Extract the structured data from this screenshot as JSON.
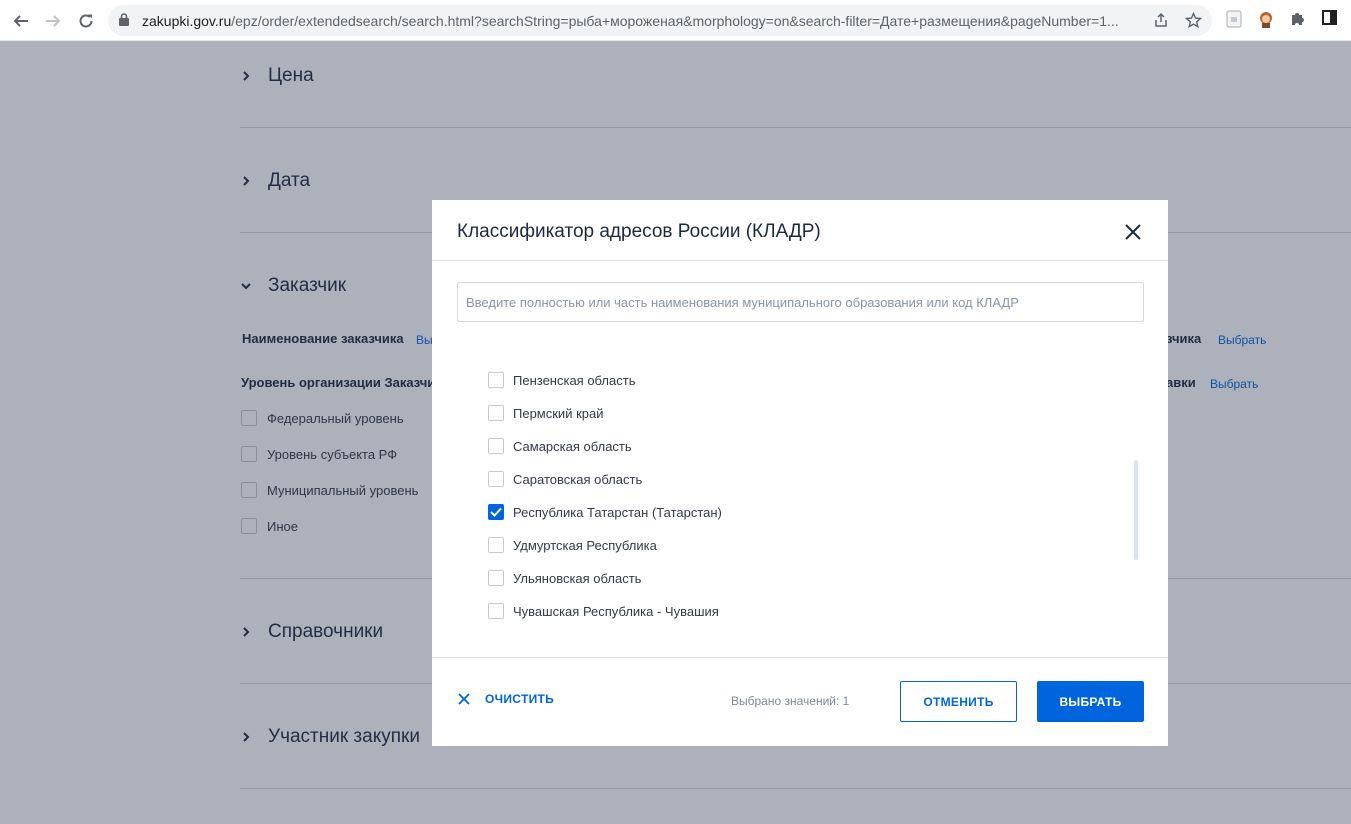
{
  "browser": {
    "url_domain": "zakupki.gov.ru",
    "url_path": "/epz/order/extendedsearch/search.html?searchString=рыба+мороженая&morphology=on&search-filter=Дате+размещения&pageNumber=1..."
  },
  "background": {
    "sections": [
      {
        "title": "Цена",
        "expanded": false
      },
      {
        "title": "Дата",
        "expanded": false
      },
      {
        "title": "Заказчик",
        "expanded": true
      },
      {
        "title": "Справочники",
        "expanded": false
      },
      {
        "title": "Участник закупки",
        "expanded": false
      }
    ],
    "customer_name_label": "Наименование заказчика",
    "customer_name_link": "Вы",
    "org_level_label": "Уровень организации Заказчик",
    "right_label_1": "зчика",
    "right_link_1": "Выбрать",
    "right_label_2": "авки",
    "right_link_2": "Выбрать",
    "levels": [
      "Федеральный уровень",
      "Уровень субъекта РФ",
      "Муниципальный уровень",
      "Иное"
    ]
  },
  "modal": {
    "title": "Классификатор адресов России (КЛАДР)",
    "search_placeholder": "Введите полностью или часть наименования муниципального образования или код КЛАДР",
    "items": [
      {
        "label": "Пензенская область",
        "checked": false
      },
      {
        "label": "Пермский край",
        "checked": false
      },
      {
        "label": "Самарская область",
        "checked": false
      },
      {
        "label": "Саратовская область",
        "checked": false
      },
      {
        "label": "Республика Татарстан (Татарстан)",
        "checked": true
      },
      {
        "label": "Удмуртская Республика",
        "checked": false
      },
      {
        "label": "Ульяновская область",
        "checked": false
      },
      {
        "label": "Чувашская Республика - Чувашия",
        "checked": false
      }
    ],
    "clear_label": "ОЧИСТИТЬ",
    "selected_count": "Выбрано значений: 1",
    "cancel_label": "ОТМЕНИТЬ",
    "select_label": "ВЫБРАТЬ"
  },
  "colors": {
    "accent": "#0065dd",
    "overlay": "rgba(40, 50, 75, 0.38)"
  }
}
